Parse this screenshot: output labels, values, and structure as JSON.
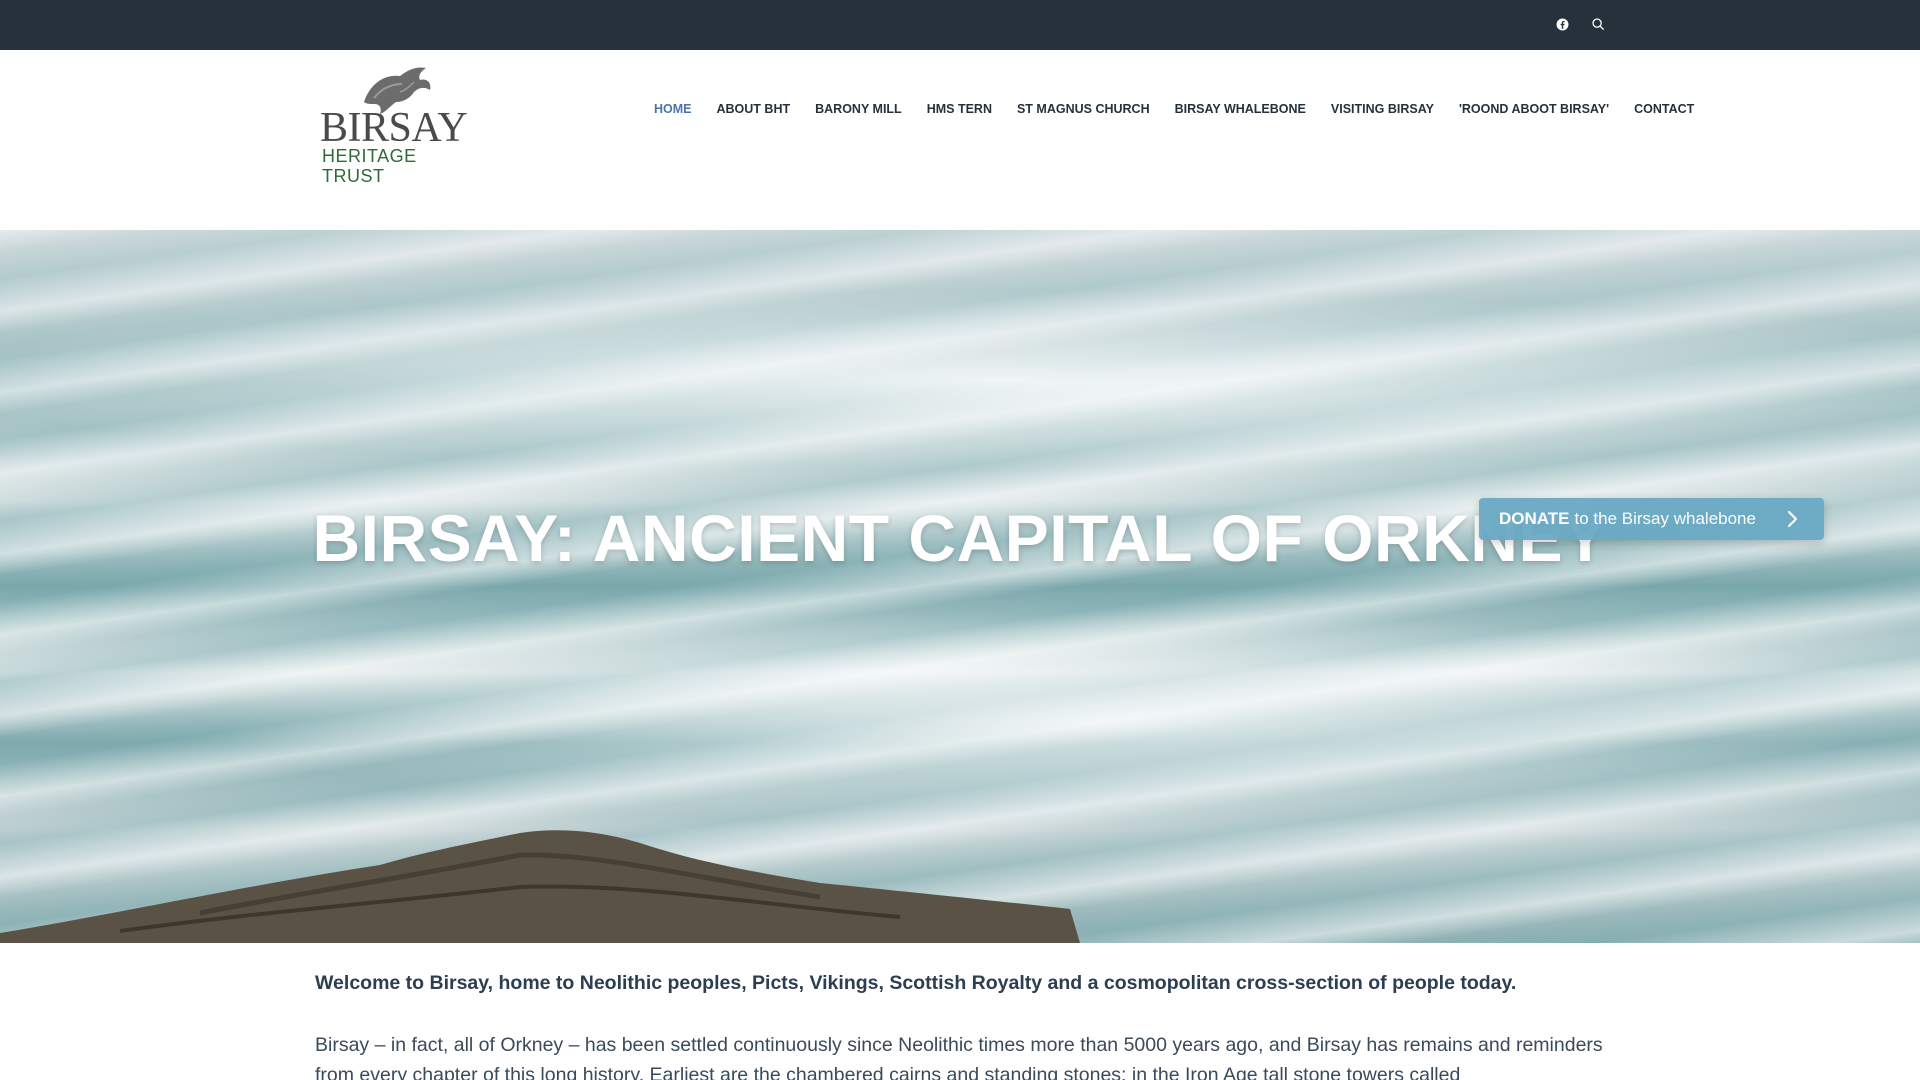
{
  "topbar": {
    "icons": [
      "facebook-icon",
      "search-icon"
    ]
  },
  "logo": {
    "line1": "BIRSAY",
    "line2": "HERITAGE TRUST"
  },
  "nav": {
    "items": [
      {
        "label": "HOME",
        "active": true
      },
      {
        "label": "ABOUT BHT"
      },
      {
        "label": "BARONY MILL"
      },
      {
        "label": "HMS TERN"
      },
      {
        "label": "ST MAGNUS CHURCH"
      },
      {
        "label": "BIRSAY WHALEBONE"
      },
      {
        "label": "VISITING BIRSAY"
      },
      {
        "label": "'ROOND ABOOT BIRSAY'"
      },
      {
        "label": "CONTACT"
      }
    ]
  },
  "hero": {
    "title": "BIRSAY: ANCIENT CAPITAL OF ORKNEY"
  },
  "donate": {
    "strong": "DONATE",
    "text": "to the Birsay whalebone"
  },
  "content": {
    "lead": "Welcome to Birsay, home to Neolithic peoples, Picts, Vikings, Scottish Royalty and a cosmopolitan cross-section of people today.",
    "paragraph": "Birsay – in fact, all of Orkney – has been settled continuously since Neolithic times more than 5000 years ago, and Birsay has remains and reminders from every chapter of this long history. Earliest are the chambered cairns and standing stones; in the Iron Age tall stone towers called"
  },
  "colors": {
    "topbar": "#27313c",
    "nav_active": "#4b73a8",
    "donate_bg": "#6aa9c4",
    "logo_green": "#2e6a3a"
  }
}
